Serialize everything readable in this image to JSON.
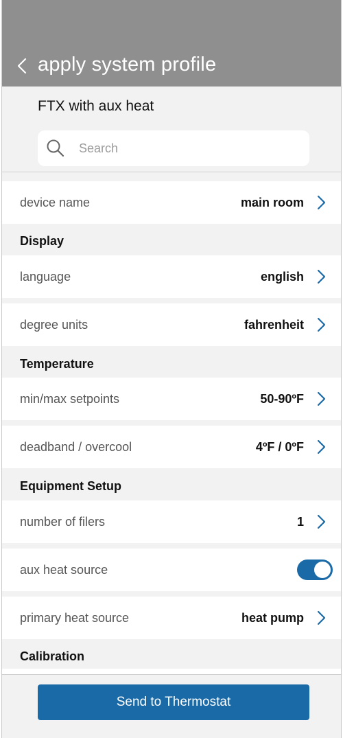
{
  "header": {
    "title": "apply system profile"
  },
  "profile_name": "FTX with aux heat",
  "search": {
    "placeholder": "Search"
  },
  "rows": {
    "device_name": {
      "label": "device name",
      "value": "main room"
    },
    "language": {
      "label": "language",
      "value": "english"
    },
    "degree_units": {
      "label": "degree units",
      "value": "fahrenheit"
    },
    "setpoints": {
      "label": "min/max setpoints",
      "value": "50-90ºF"
    },
    "deadband": {
      "label": "deadband / overcool",
      "value": "4ºF / 0ºF"
    },
    "filters": {
      "label": "number of filers",
      "value": "1"
    },
    "aux_heat": {
      "label": "aux heat source",
      "toggle_on": true
    },
    "primary_heat": {
      "label": "primary heat source",
      "value": "heat pump"
    }
  },
  "sections": {
    "display": "Display",
    "temperature": "Temperature",
    "equipment": "Equipment Setup",
    "calibration": "Calibration"
  },
  "footer": {
    "send_label": "Send to Thermostat"
  },
  "colors": {
    "header_bg": "#8f8f8f",
    "accent": "#1a6aa8",
    "chevron": "#1a6aa8"
  }
}
